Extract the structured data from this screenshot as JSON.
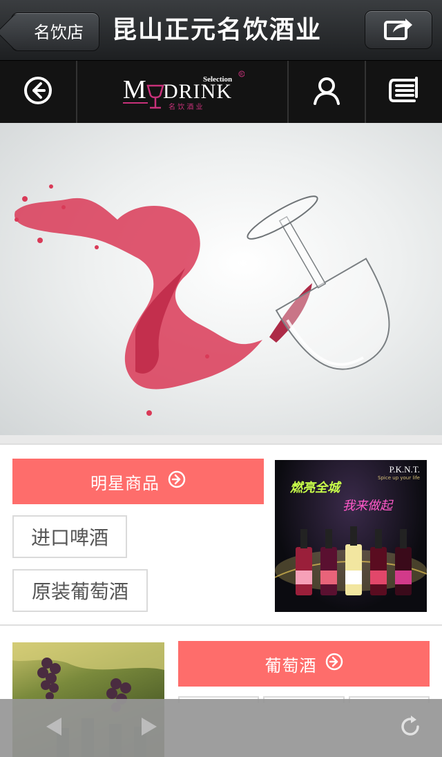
{
  "titlebar": {
    "back_label": "名饮店",
    "title": "昆山正元名饮酒业"
  },
  "logo": {
    "selection": "Selection",
    "brand": "DRINK",
    "m_letter": "M",
    "y_letter": "Y",
    "chinese": "名 饮 酒 业",
    "registered": "R"
  },
  "section_featured": {
    "button_label": "明星商品",
    "tags": [
      "进口啤酒",
      "原装葡萄酒"
    ],
    "promo": {
      "brand": "P.K.N.T.",
      "tagline": "Spice up your life",
      "headline1": "燃亮全城",
      "headline2": "我来做起"
    }
  },
  "section_wine": {
    "button_label": "葡萄酒"
  },
  "colors": {
    "accent": "#fe6d6b",
    "header_dark": "#1d1f21",
    "nav_dark": "#131313",
    "logo_pink": "#c8317a"
  },
  "icons": {
    "back": "chevron-left-icon",
    "share": "share-icon",
    "nav_back": "circle-arrow-left-icon",
    "user": "user-icon",
    "list": "list-icon",
    "arrow": "circle-arrow-right-icon",
    "browser_back": "triangle-left-icon",
    "browser_forward": "triangle-right-icon",
    "refresh": "refresh-icon"
  }
}
